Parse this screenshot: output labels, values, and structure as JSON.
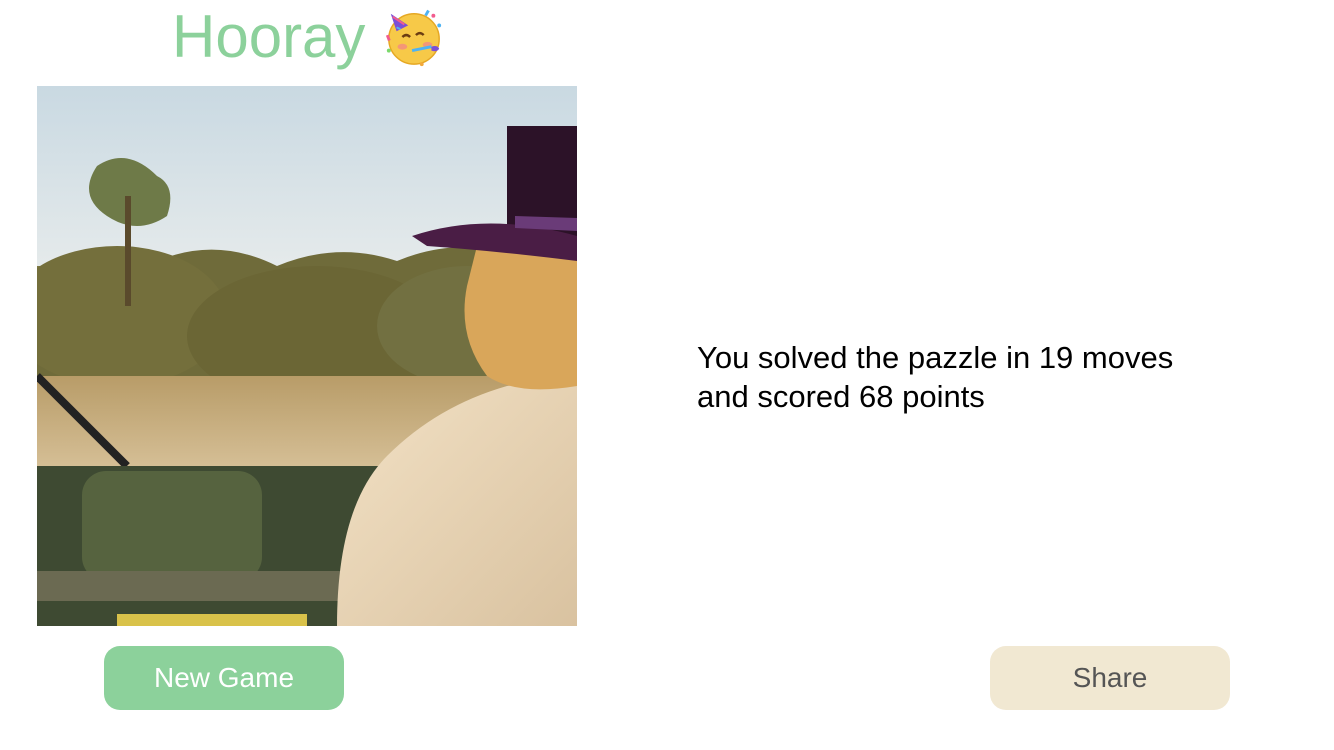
{
  "header": {
    "title": "Hooray",
    "emoji_icon": "partying-face-icon"
  },
  "puzzle": {
    "image_description_icon": "solved-puzzle-image",
    "state": "solved"
  },
  "result": {
    "line1": "You solved the pazzle in 19 moves",
    "line2": "and scored 68 points",
    "moves": 19,
    "points": 68
  },
  "actions": {
    "new_game_label": "New Game",
    "share_label": "Share"
  },
  "colors": {
    "accent_green": "#8cd19b",
    "share_beige": "#f1e8d2",
    "share_text": "#555555"
  }
}
